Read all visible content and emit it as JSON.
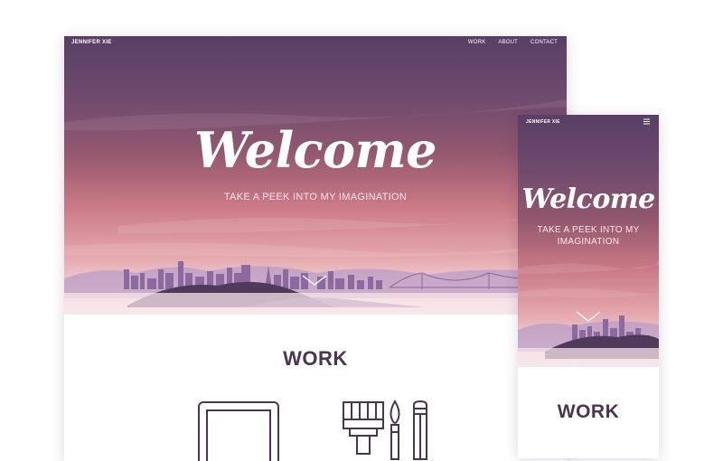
{
  "desktop": {
    "brand": "JENNIFER XIE",
    "nav": [
      {
        "label": "WORK"
      },
      {
        "label": "ABOUT"
      },
      {
        "label": "CONTACT"
      }
    ],
    "hero": {
      "title": "Welcome",
      "tagline": "TAKE A PEEK INTO MY IMAGINATION"
    },
    "work_section": {
      "title": "WORK"
    },
    "icons": [
      "tablet-icon",
      "paintbrush-icon",
      "brush-icon",
      "pencil-icon",
      "scroll-down-chevron-icon"
    ]
  },
  "mobile": {
    "brand": "JENNIFER XIE",
    "hero": {
      "title": "Welcome",
      "tagline": "TAKE A PEEK INTO MY IMAGINATION"
    },
    "work_section": {
      "title": "WORK"
    },
    "icons": [
      "hamburger-menu-icon",
      "scroll-down-chevron-icon"
    ]
  },
  "colors": {
    "hero_top": "#583f64",
    "hero_mid": "#c87784",
    "hero_bottom": "#f9ecee",
    "heading": "#4a3550",
    "skyline": "#8a6a9f"
  }
}
